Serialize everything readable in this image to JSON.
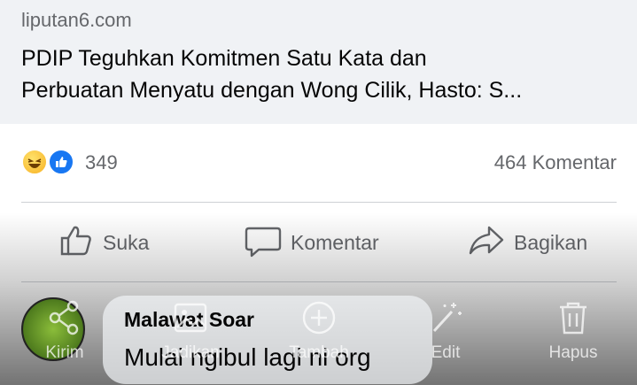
{
  "link_preview": {
    "domain": "liputan6.com",
    "headline_line1": "PDIP Teguhkan Komitmen Satu Kata dan",
    "headline_line2": "Perbuatan Menyatu dengan Wong Cilik, Hasto: S..."
  },
  "reactions": {
    "icons": [
      "haha-emoji-icon",
      "like-emoji-icon"
    ],
    "count": "349",
    "comments": "464 Komentar"
  },
  "actions": {
    "like": "Suka",
    "comment": "Komentar",
    "share": "Bagikan"
  },
  "toolbar": {
    "send": "Kirim",
    "make": "Jadikan",
    "add": "Tambah",
    "edit": "Edit",
    "delete": "Hapus"
  },
  "comment": {
    "author": "Malawat Soar",
    "text": "Mulai ngibul lagi ni org"
  },
  "colors": {
    "secondary_text": "#65676b",
    "like_blue": "#1877f2",
    "preview_bg": "#f0f2f5"
  }
}
